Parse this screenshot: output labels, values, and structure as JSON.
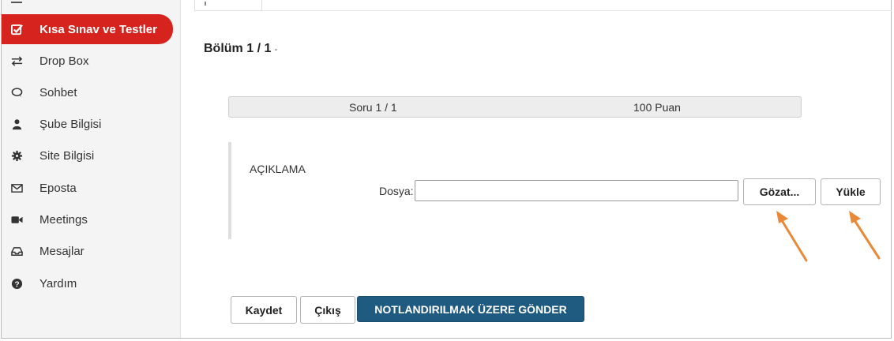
{
  "sidebar": {
    "items": [
      {
        "label": "Kısa Sınav ve Testler",
        "icon": "checkbox-icon",
        "active": true
      },
      {
        "label": "Drop Box",
        "icon": "swap-arrows-icon"
      },
      {
        "label": "Sohbet",
        "icon": "chat-bubble-icon"
      },
      {
        "label": "Şube Bilgisi",
        "icon": "user-icon"
      },
      {
        "label": "Site Bilgisi",
        "icon": "gear-icon"
      },
      {
        "label": "Eposta",
        "icon": "envelope-icon"
      },
      {
        "label": "Meetings",
        "icon": "video-camera-icon"
      },
      {
        "label": "Mesajlar",
        "icon": "inbox-tray-icon"
      },
      {
        "label": "Yardım",
        "icon": "help-circle-icon"
      }
    ]
  },
  "main": {
    "section_title": "Bölüm 1 / 1",
    "section_suffix": "-",
    "question_number": "Soru 1 / 1",
    "question_points": "100 Puan",
    "question_text": "AÇIKLAMA",
    "file_label": "Dosya:",
    "file_value": "",
    "browse_label": "Gözat...",
    "upload_label": "Yükle"
  },
  "footer": {
    "save_label": "Kaydet",
    "exit_label": "Çıkış",
    "submit_label": "NOTLANDIRILMAK ÜZERE GÖNDER"
  },
  "colors": {
    "active_nav": "#d6231d",
    "submit_button": "#1f5b80",
    "annotation_arrow": "#e8893a"
  }
}
